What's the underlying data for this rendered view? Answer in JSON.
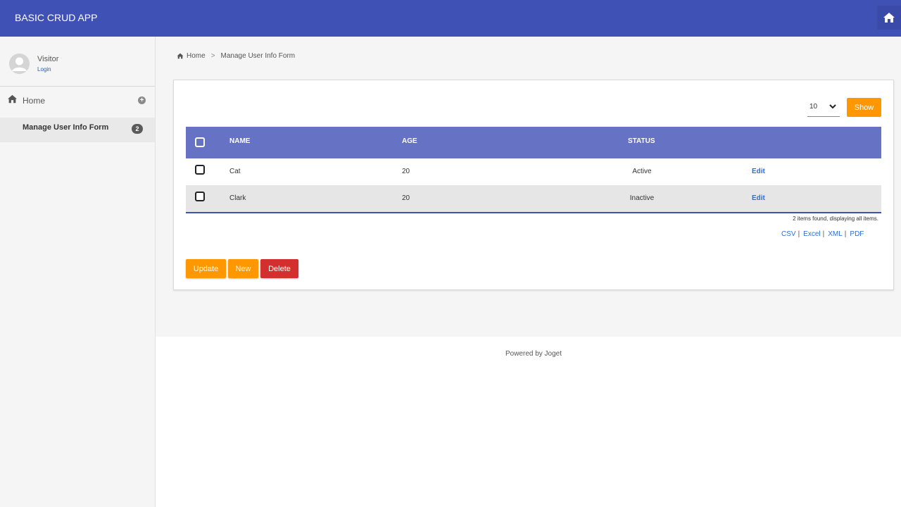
{
  "header": {
    "app_title": "BASIC CRUD APP",
    "home_icon": "home-icon",
    "color": "#3f51b5"
  },
  "sidebar": {
    "user": {
      "name": "Visitor",
      "login_label": "Login"
    },
    "items": [
      {
        "label": "Home",
        "icon": "home-icon",
        "expand_icon": "plus-circle-icon"
      },
      {
        "label": "Manage User Info Form",
        "badge": "2"
      }
    ]
  },
  "breadcrumb": {
    "home": "Home",
    "separator": ">",
    "current": "Manage User Info Form"
  },
  "list": {
    "page_size": "10",
    "show_label": "Show",
    "columns": [
      "NAME",
      "AGE",
      "STATUS"
    ],
    "rows": [
      {
        "name": "Cat",
        "age": "20",
        "status": "Active",
        "action": "Edit"
      },
      {
        "name": "Clark",
        "age": "20",
        "status": "Inactive",
        "action": "Edit"
      }
    ],
    "found_text": "2 items found, displaying all items.",
    "exports": [
      "CSV",
      "Excel",
      "XML",
      "PDF"
    ]
  },
  "actions": {
    "update": "Update",
    "new": "New",
    "delete": "Delete"
  },
  "footer": {
    "text": "Powered by Joget"
  },
  "colors": {
    "accent": "#ff9800",
    "danger": "#d32f2f",
    "table_header": "#6672c4",
    "link": "#2a6fd6"
  }
}
